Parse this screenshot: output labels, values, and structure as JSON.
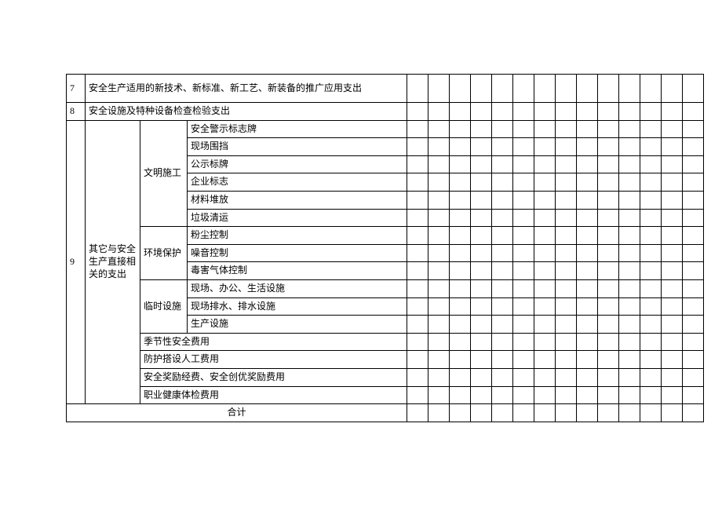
{
  "rows": {
    "r7": {
      "idx": "7",
      "desc": "安全生产适用的新技术、新标准、新工艺、新装备的推广应用支出"
    },
    "r8": {
      "idx": "8",
      "desc": "安全设施及特种设备检查检验支出"
    },
    "r9": {
      "idx": "9",
      "label": "其它与安全生产直接相关的支出",
      "groups": {
        "civil": {
          "name": "文明施工",
          "items": {
            "a": "安全警示标志牌",
            "b": "现场围挡",
            "c": "公示标牌",
            "d": "企业标志",
            "e": "材料堆放",
            "f": "垃圾清运"
          }
        },
        "env": {
          "name": "环境保护",
          "items": {
            "a": "粉尘控制",
            "b": "噪音控制",
            "c": "毒害气体控制"
          }
        },
        "temp": {
          "name": "临时设施",
          "items": {
            "a": "现场、办公、生活设施",
            "b": "现场排水、排水设施",
            "c": "生产设施"
          }
        },
        "seasonal": "季节性安全费用",
        "protection": "防护搭设人工费用",
        "reward": "安全奖励经费、安全创优奖励费用",
        "health": "职业健康体检费用"
      }
    },
    "total": "合计"
  }
}
